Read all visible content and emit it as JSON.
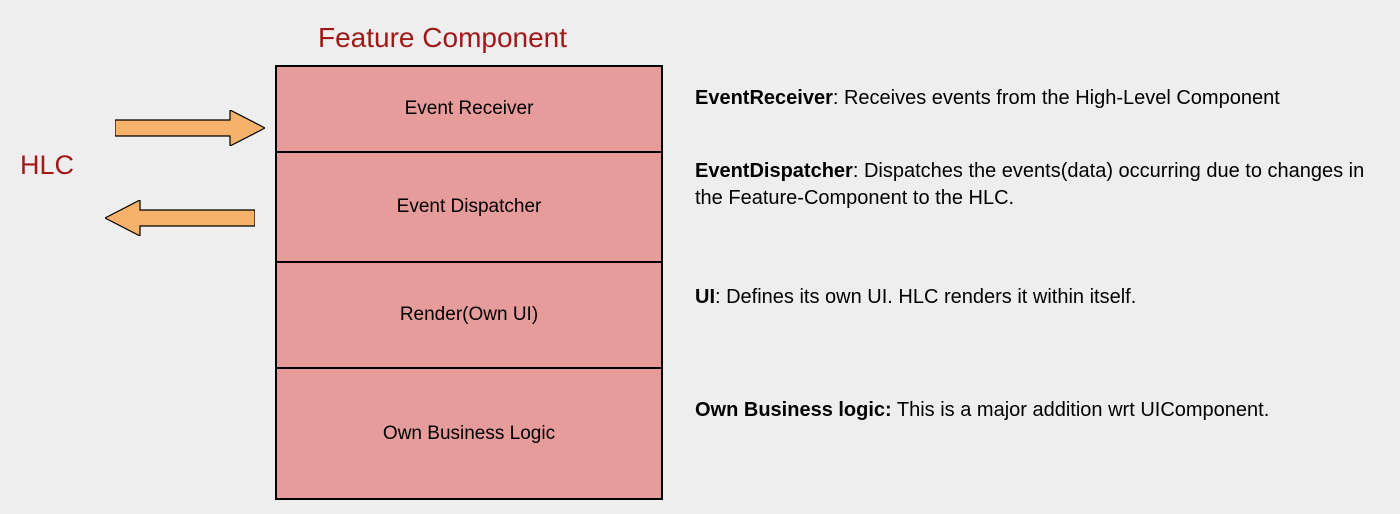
{
  "hlc_label": "HLC",
  "title": "Feature Component",
  "boxes": [
    {
      "label": "Event Receiver"
    },
    {
      "label": "Event Dispatcher"
    },
    {
      "label": "Render(Own UI)"
    },
    {
      "label": "Own Business Logic"
    }
  ],
  "descriptions": [
    {
      "bold": "EventReceiver",
      "text": ": Receives events from the High-Level Component"
    },
    {
      "bold": "EventDispatcher",
      "text": ": Dispatches the events(data) occurring due to changes in the Feature-Component to the HLC."
    },
    {
      "bold": "UI",
      "text": ": Defines its own UI. HLC renders it within itself."
    },
    {
      "bold": "Own Business logic:",
      "text": "  This is a major addition wrt UIComponent."
    }
  ],
  "colors": {
    "accent": "#a01818",
    "box_fill": "#e79c9c",
    "arrow_fill": "#f6b26b",
    "arrow_stroke": "#000000"
  }
}
